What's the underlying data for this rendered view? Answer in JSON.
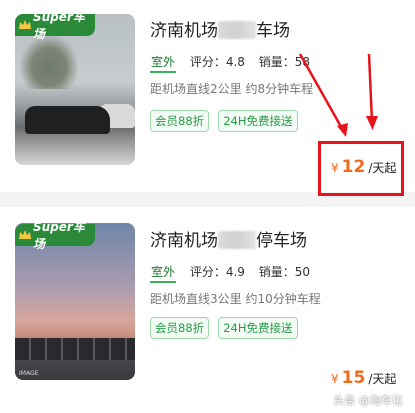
{
  "listings": [
    {
      "badge": "Super车场",
      "title_start": "济南机场",
      "title_end": "车场",
      "tag": "室外",
      "rating_label": "评分：",
      "rating": "4.8",
      "sales_label": "销量：",
      "sales": "58",
      "distance": "距机场直线2公里 约8分钟车程",
      "chips": [
        "会员88折",
        "24H免费接送"
      ],
      "currency": "¥",
      "price": "12",
      "price_unit": "/天起"
    },
    {
      "badge": "Super车场",
      "title_start": "济南机场",
      "title_end": "停车场",
      "tag": "室外",
      "rating_label": "评分：",
      "rating": "4.9",
      "sales_label": "销量：",
      "sales": "50",
      "distance": "距机场直线3公里 约10分钟车程",
      "chips": [
        "会员88折",
        "24H免费接送"
      ],
      "currency": "¥",
      "price": "15",
      "price_unit": "/天起",
      "photo_watermark": "IMAGE"
    }
  ],
  "watermark": "头条 @淘车位",
  "colors": {
    "brand_green": "#2a8a3a",
    "price_orange": "#f26a1b",
    "annotation_red": "#e8141a"
  },
  "icons": [
    "crown-icon",
    "arrow-annotation-icon"
  ]
}
